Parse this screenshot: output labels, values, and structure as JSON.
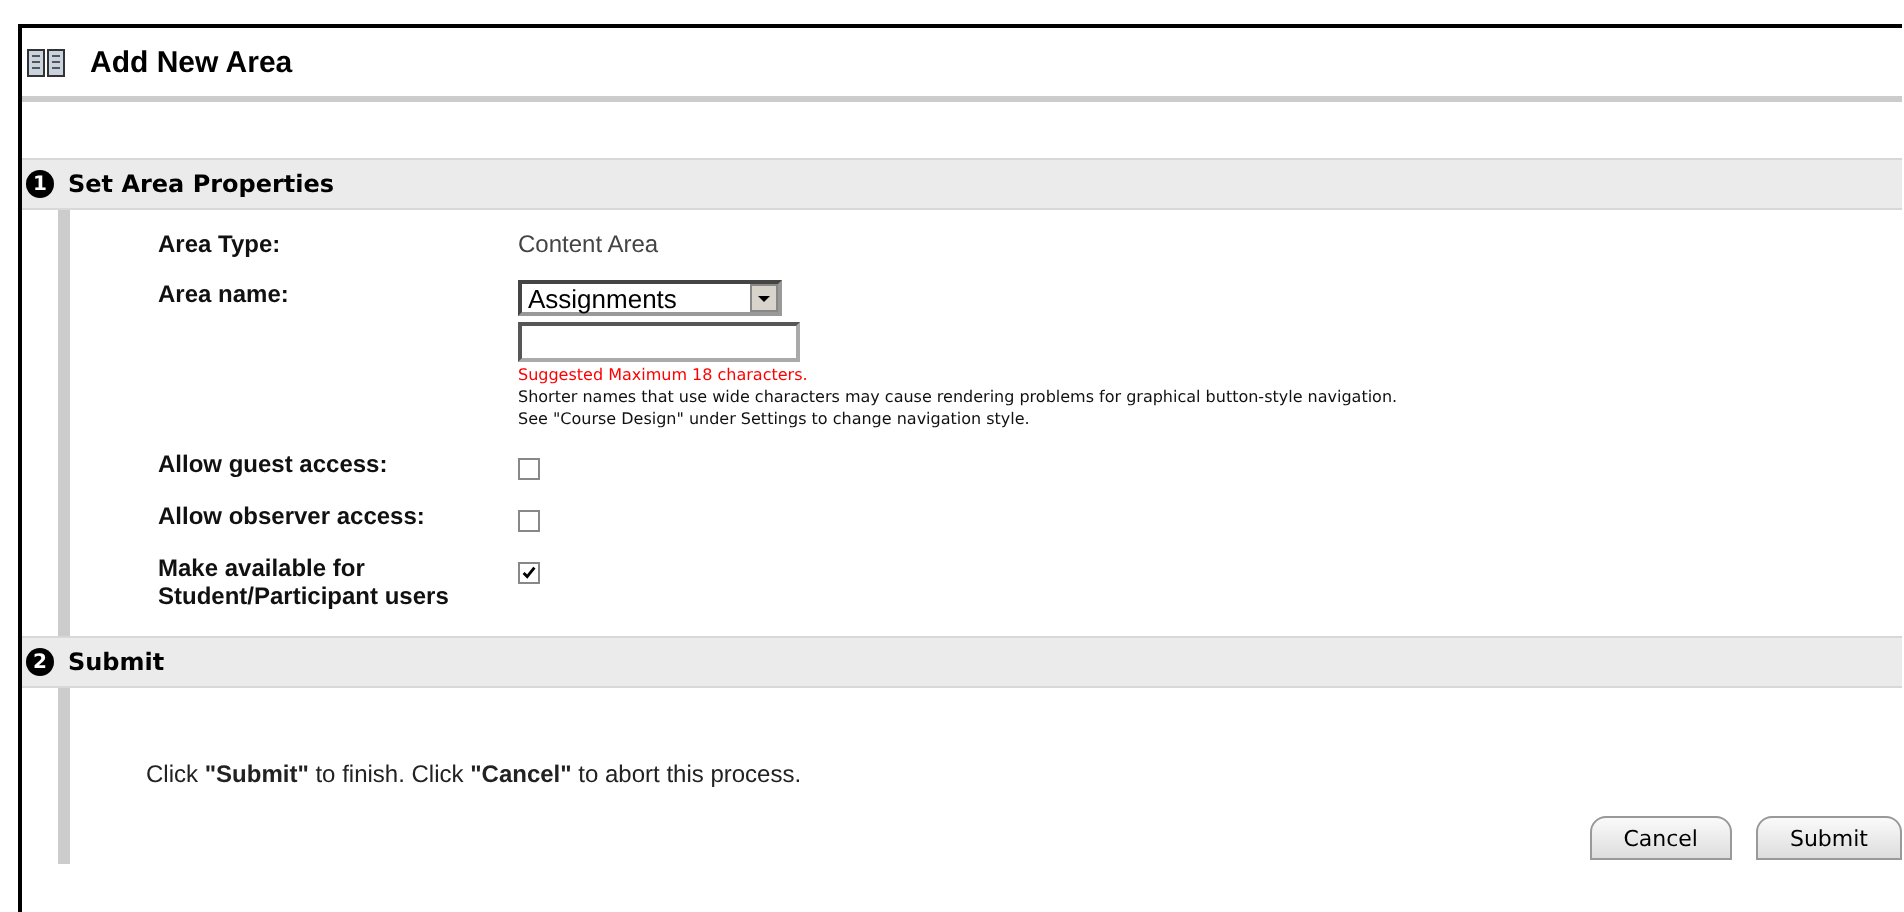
{
  "page": {
    "title": "Add New Area"
  },
  "steps": [
    {
      "number": "1",
      "title": "Set Area Properties"
    },
    {
      "number": "2",
      "title": "Submit"
    }
  ],
  "fields": [
    {
      "kind": "text",
      "label": "Area Type:",
      "value": "Content Area"
    },
    {
      "kind": "name",
      "label": "Area name:",
      "select": "Assignments",
      "warning": "Suggested Maximum 18 characters.",
      "notes": [
        "Shorter names that use wide characters may cause rendering problems for graphical button-style navigation.",
        "See \"Course Design\" under Settings to change navigation style."
      ]
    },
    {
      "kind": "checkbox",
      "label": "Allow guest access:",
      "checked": false
    },
    {
      "kind": "checkbox",
      "label": "Allow observer access:",
      "checked": false
    },
    {
      "kind": "checkbox",
      "label": "Make available for Student/Participant users",
      "checked": true
    }
  ],
  "instruction": "Click **\"Submit\"** to finish. Click **\"Cancel\"** to abort this process.",
  "buttons": [
    "Cancel",
    "Submit"
  ]
}
